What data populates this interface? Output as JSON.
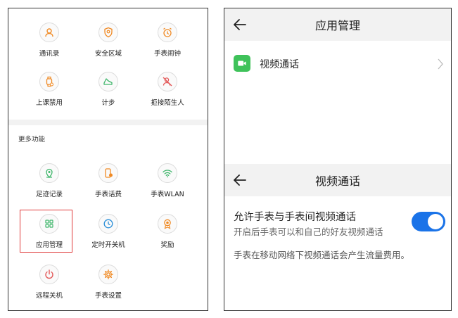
{
  "left_panel": {
    "top_items": [
      {
        "label": "通讯录",
        "icon": "contacts-icon"
      },
      {
        "label": "安全区域",
        "icon": "shield-icon"
      },
      {
        "label": "手表闹钟",
        "icon": "alarm-clock-icon"
      },
      {
        "label": "上课禁用",
        "icon": "watch-lock-icon"
      },
      {
        "label": "计步",
        "icon": "shoe-icon"
      },
      {
        "label": "拒接陌生人",
        "icon": "block-person-icon"
      }
    ],
    "section_title": "更多功能",
    "more_items": [
      {
        "label": "足迹记录",
        "icon": "location-pin-icon"
      },
      {
        "label": "手表话费",
        "icon": "phone-bill-icon"
      },
      {
        "label": "手表WLAN",
        "icon": "wifi-icon"
      },
      {
        "label": "应用管理",
        "icon": "apps-grid-icon"
      },
      {
        "label": "定时开关机",
        "icon": "clock-icon"
      },
      {
        "label": "奖励",
        "icon": "medal-icon"
      },
      {
        "label": "远程关机",
        "icon": "power-icon"
      },
      {
        "label": "手表设置",
        "icon": "gear-icon"
      }
    ],
    "icon_color": "#f08a24",
    "highlight_color": "#e03a3a"
  },
  "app_manage": {
    "title": "应用管理",
    "apps": [
      {
        "name": "视频通话",
        "icon": "video-call-icon",
        "color": "#3fc25a"
      }
    ]
  },
  "video_call": {
    "title": "视频通话",
    "setting_title": "允许手表与手表间视频通话",
    "setting_subtitle": "开启后手表可以和自己的好友视频通话",
    "toggle_on": true,
    "toggle_color": "#1a73e8",
    "note": "手表在移动网络下视频通话会产生流量费用。"
  }
}
